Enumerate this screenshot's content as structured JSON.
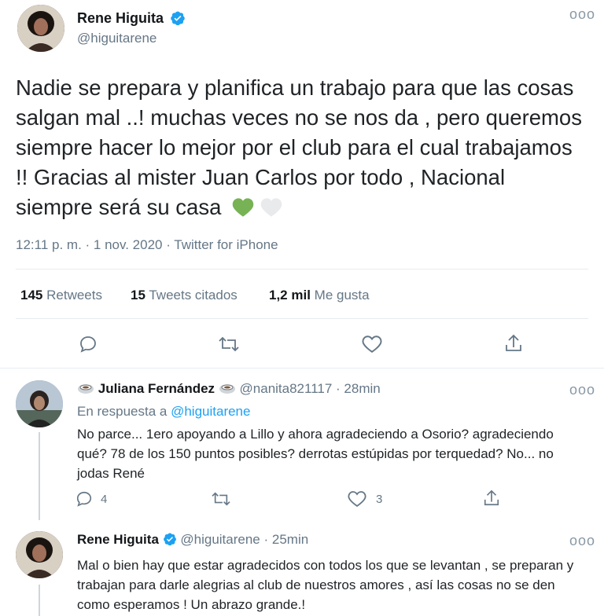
{
  "main_tweet": {
    "name": "Rene Higuita",
    "handle": "@higuitarene",
    "text": "Nadie se prepara y planifica un trabajo para que las cosas salgan mal ..! muchas veces no se nos da , pero queremos siempre hacer lo mejor por el club para el cual trabajamos !! Gracias al mister Juan Carlos por todo , Nacional siempre será su casa",
    "timestamp": "12:11 p. m. · 1 nov. 2020 · Twitter for iPhone",
    "stats": {
      "retweets_count": "145",
      "retweets_label": "Retweets",
      "quotes_count": "15",
      "quotes_label": "Tweets citados",
      "likes_count": "1,2 mil",
      "likes_label": "Me gusta"
    }
  },
  "reply1": {
    "name": "Juliana Fernández",
    "handle": "@nanita821117",
    "time": "· 28min",
    "in_reply_label": "En respuesta a",
    "in_reply_handle": "@higuitarene",
    "text": "No parce... 1ero apoyando a Lillo y ahora agradeciendo a Osorio? agradeciendo qué? 78 de los 150 puntos posibles? derrotas estúpidas por terquedad? No... no jodas René",
    "reply_count": "4",
    "like_count": "3"
  },
  "reply2": {
    "name": "Rene Higuita",
    "handle": "@higuitarene",
    "time": "· 25min",
    "text": "Mal o bien hay que estar agradecidos con todos los que se levantan , se preparan y trabajan para darle alegrias al club de nuestros amores , así las cosas no se den como esperamos ! Un abrazo grande.!"
  },
  "icons": [
    "reply-icon",
    "retweet-icon",
    "like-icon",
    "share-icon",
    "more-icon",
    "verified-icon",
    "coffee-icon"
  ],
  "colors": {
    "accent": "#1da1f2",
    "green_heart": "#77b255",
    "white_heart": "#e1e8ed"
  }
}
